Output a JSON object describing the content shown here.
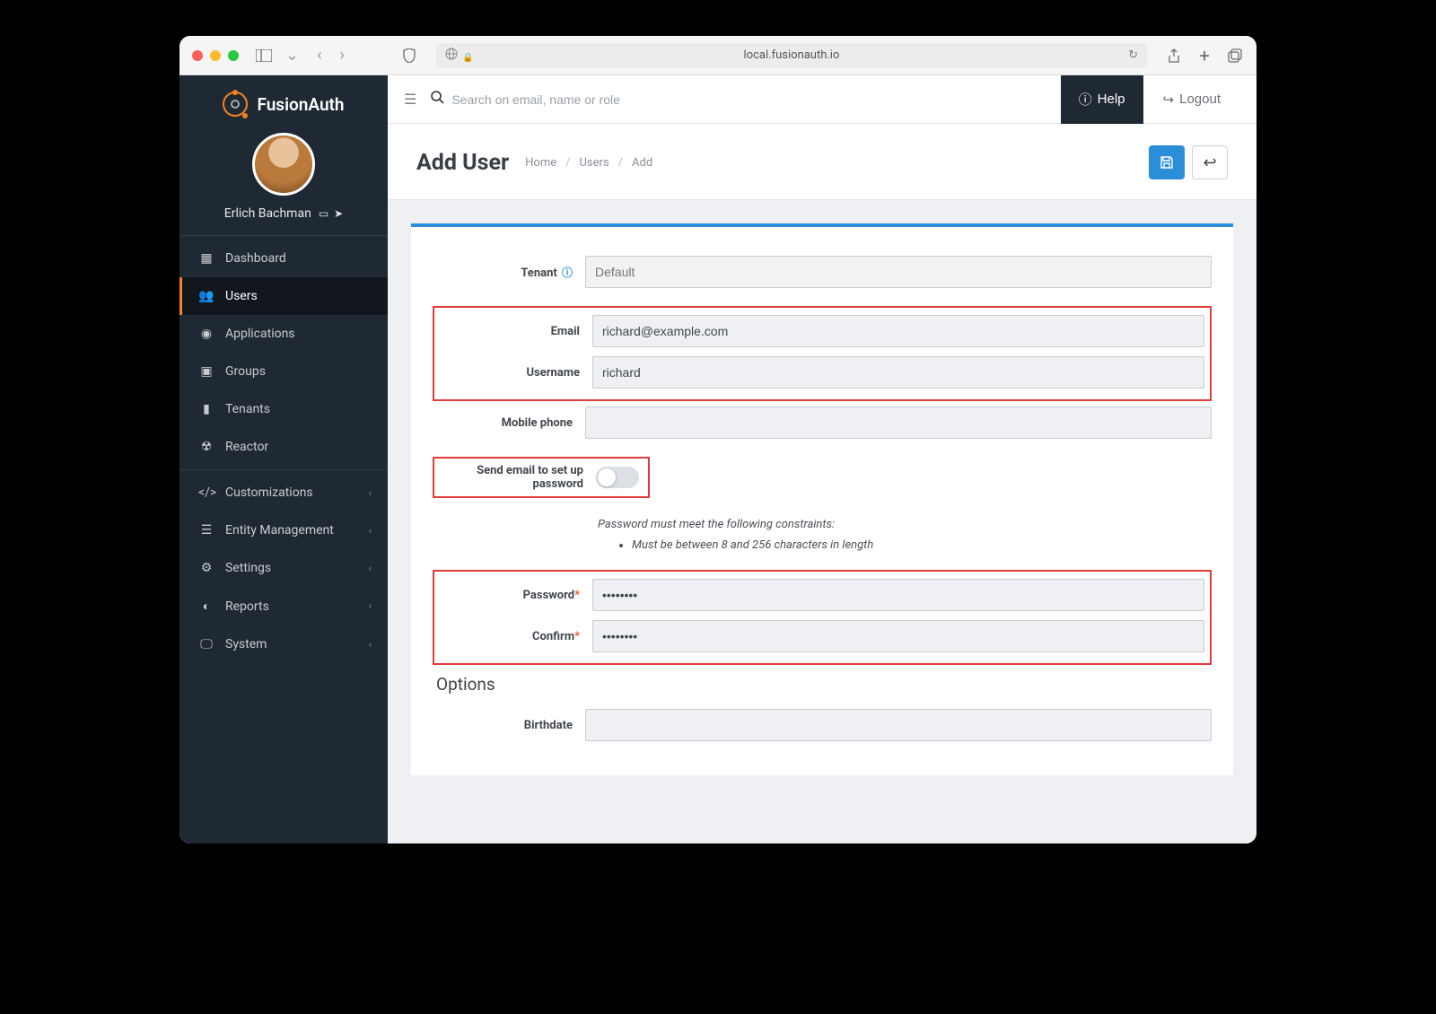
{
  "browser": {
    "url": "local.fusionauth.io"
  },
  "brand": "FusionAuth",
  "profile": {
    "name": "Erlich Bachman"
  },
  "sidebar": {
    "items": [
      {
        "label": "Dashboard",
        "icon": "▦",
        "iconName": "dashboard-icon",
        "expandable": false
      },
      {
        "label": "Users",
        "icon": "👥",
        "iconName": "users-icon",
        "active": true,
        "expandable": false
      },
      {
        "label": "Applications",
        "icon": "◉",
        "iconName": "applications-icon",
        "expandable": false
      },
      {
        "label": "Groups",
        "icon": "▣",
        "iconName": "groups-icon",
        "expandable": false
      },
      {
        "label": "Tenants",
        "icon": "▮",
        "iconName": "tenants-icon",
        "expandable": false
      },
      {
        "label": "Reactor",
        "icon": "☢",
        "iconName": "reactor-icon",
        "expandable": false
      },
      {
        "divider": true
      },
      {
        "label": "Customizations",
        "icon": "</>",
        "iconName": "code-icon",
        "expandable": true
      },
      {
        "label": "Entity Management",
        "icon": "☰",
        "iconName": "entity-icon",
        "expandable": true
      },
      {
        "label": "Settings",
        "icon": "⚙",
        "iconName": "settings-icon",
        "expandable": true
      },
      {
        "label": "Reports",
        "icon": "◐",
        "iconName": "reports-icon",
        "expandable": true
      },
      {
        "label": "System",
        "icon": "🖵",
        "iconName": "system-icon",
        "expandable": true
      }
    ]
  },
  "topbar": {
    "searchPlaceholder": "Search on email, name or role",
    "help": "Help",
    "logout": "Logout"
  },
  "page": {
    "title": "Add User",
    "breadcrumb": [
      "Home",
      "Users",
      "Add"
    ]
  },
  "form": {
    "tenant": {
      "label": "Tenant",
      "value": "Default"
    },
    "email": {
      "label": "Email",
      "value": "richard@example.com"
    },
    "username": {
      "label": "Username",
      "value": "richard"
    },
    "mobile": {
      "label": "Mobile phone",
      "value": ""
    },
    "sendEmail": {
      "label": "Send email to set up password",
      "value": false
    },
    "constraintsHeader": "Password must meet the following constraints:",
    "constraints": [
      "Must be between 8 and 256 characters in length"
    ],
    "password": {
      "label": "Password",
      "value": "••••••••"
    },
    "confirm": {
      "label": "Confirm",
      "value": "••••••••"
    },
    "optionsTitle": "Options",
    "birthdate": {
      "label": "Birthdate",
      "value": ""
    }
  }
}
